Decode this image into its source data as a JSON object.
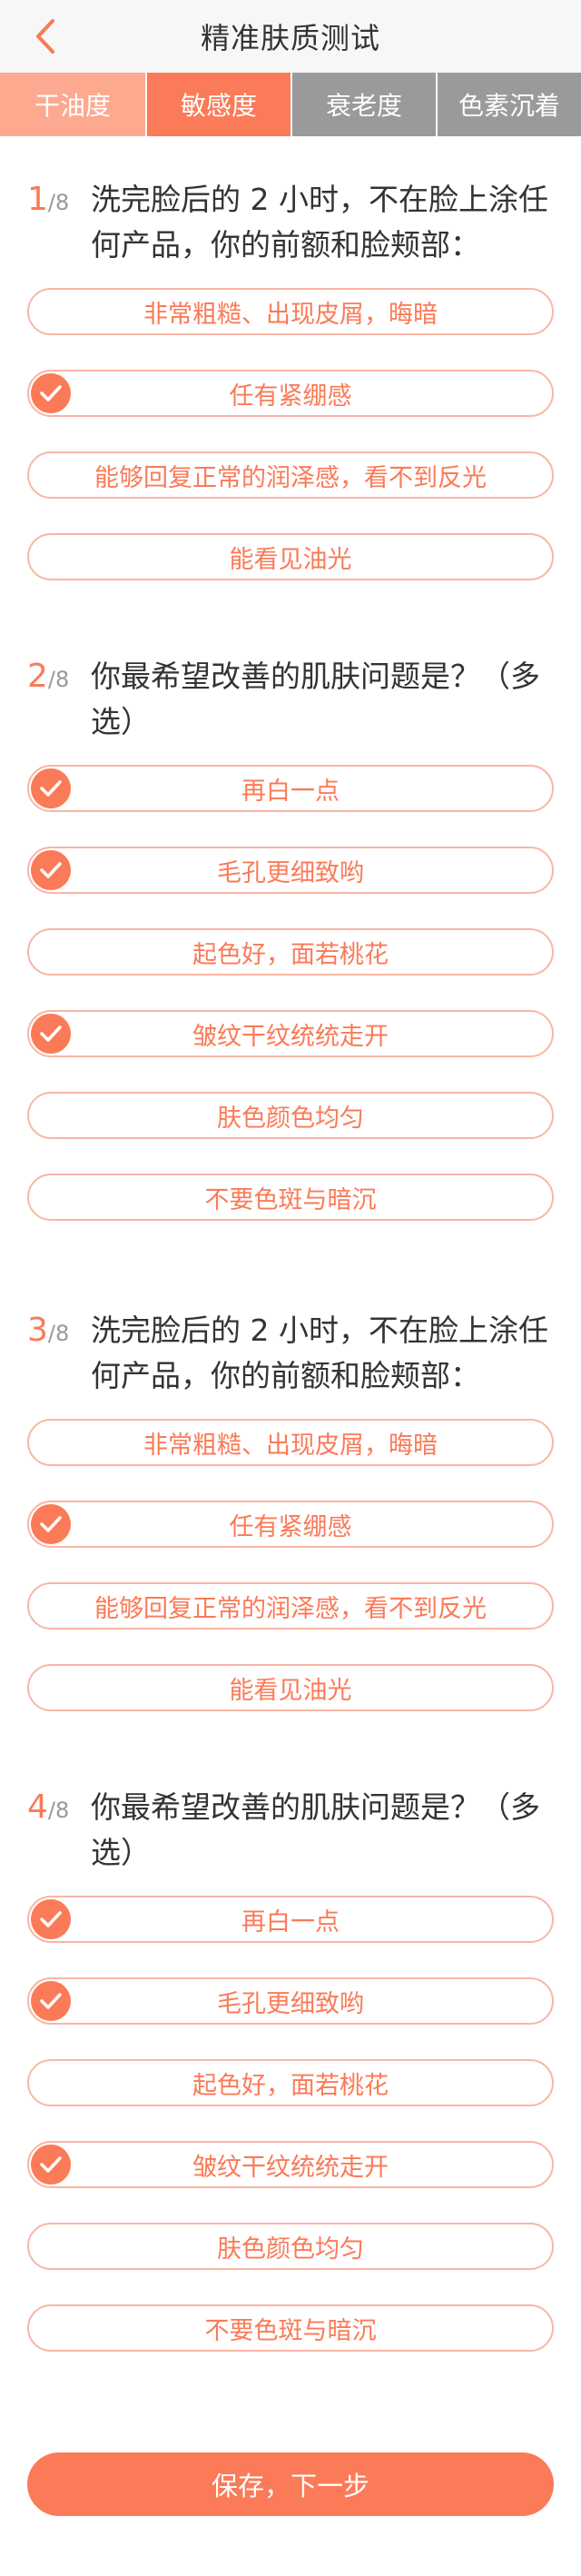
{
  "header": {
    "title": "精准肤质测试",
    "back_icon": "chevron-left-icon"
  },
  "tabs": [
    {
      "label": "干油度",
      "state": "done"
    },
    {
      "label": "敏感度",
      "state": "active"
    },
    {
      "label": "衰老度",
      "state": "todo"
    },
    {
      "label": "色素沉着",
      "state": "todo"
    }
  ],
  "questions": [
    {
      "number": "1",
      "total": "8",
      "text": "洗完脸后的 2 小时，不在脸上涂任何产品，你的前额和脸颊部：",
      "options": [
        {
          "label": "非常粗糙、出现皮屑，晦暗",
          "checked": false
        },
        {
          "label": "任有紧绷感",
          "checked": true
        },
        {
          "label": "能够回复正常的润泽感，看不到反光",
          "checked": false
        },
        {
          "label": "能看见油光",
          "checked": false
        }
      ]
    },
    {
      "number": "2",
      "total": "8",
      "text": "你最希望改善的肌肤问题是？（多选）",
      "options": [
        {
          "label": "再白一点",
          "checked": true
        },
        {
          "label": "毛孔更细致哟",
          "checked": true
        },
        {
          "label": "起色好，面若桃花",
          "checked": false
        },
        {
          "label": "皱纹干纹统统走开",
          "checked": true
        },
        {
          "label": "肤色颜色均匀",
          "checked": false
        },
        {
          "label": "不要色斑与暗沉",
          "checked": false
        }
      ]
    },
    {
      "number": "3",
      "total": "8",
      "text": "洗完脸后的 2 小时，不在脸上涂任何产品，你的前额和脸颊部：",
      "options": [
        {
          "label": "非常粗糙、出现皮屑，晦暗",
          "checked": false
        },
        {
          "label": "任有紧绷感",
          "checked": true
        },
        {
          "label": "能够回复正常的润泽感，看不到反光",
          "checked": false
        },
        {
          "label": "能看见油光",
          "checked": false
        }
      ]
    },
    {
      "number": "4",
      "total": "8",
      "text": "你最希望改善的肌肤问题是？（多选）",
      "options": [
        {
          "label": "再白一点",
          "checked": true
        },
        {
          "label": "毛孔更细致哟",
          "checked": true
        },
        {
          "label": "起色好，面若桃花",
          "checked": false
        },
        {
          "label": "皱纹干纹统统走开",
          "checked": true
        },
        {
          "label": "肤色颜色均匀",
          "checked": false
        },
        {
          "label": "不要色斑与暗沉",
          "checked": false
        }
      ]
    }
  ],
  "save_button": {
    "label": "保存，下一步"
  },
  "colors": {
    "accent": "#fb7a57",
    "accent_light": "#fda98f",
    "option_border": "#f9b6a4",
    "inactive_tab": "#9a9a9a"
  }
}
